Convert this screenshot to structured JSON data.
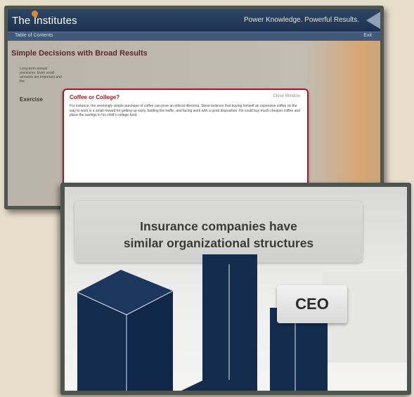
{
  "screen_top": {
    "brand": "The Institutes",
    "tagline": "Power Knowledge. Powerful Results.",
    "toolbar": {
      "toc": "Table of Contents",
      "exit": "Exit"
    },
    "page_title": "Simple Decisions with Broad Results",
    "body_text": "Long-term annual premiums. Even small amounts are important and the",
    "exercise_label": "Exercise",
    "popup": {
      "title": "Coffee or College?",
      "close": "Close Window",
      "text": "For instance, the seemingly simple purchase of coffee can pose an ethical dilemma. Steve believes that buying himself an expensive coffee on the way to work is a small reward for getting up early, battling the traffic, and facing work with a good disposition. He could buy much cheaper coffee and place the savings in his child's college fund."
    }
  },
  "screen_bottom": {
    "headline_line1": "Insurance companies have",
    "headline_line2": "similar organizational structures",
    "ceo_label": "CEO"
  },
  "colors": {
    "navy": "#142d4f",
    "header_blue": "#1d324f",
    "popup_border": "#9e1b24",
    "frame": "#4f5650"
  }
}
